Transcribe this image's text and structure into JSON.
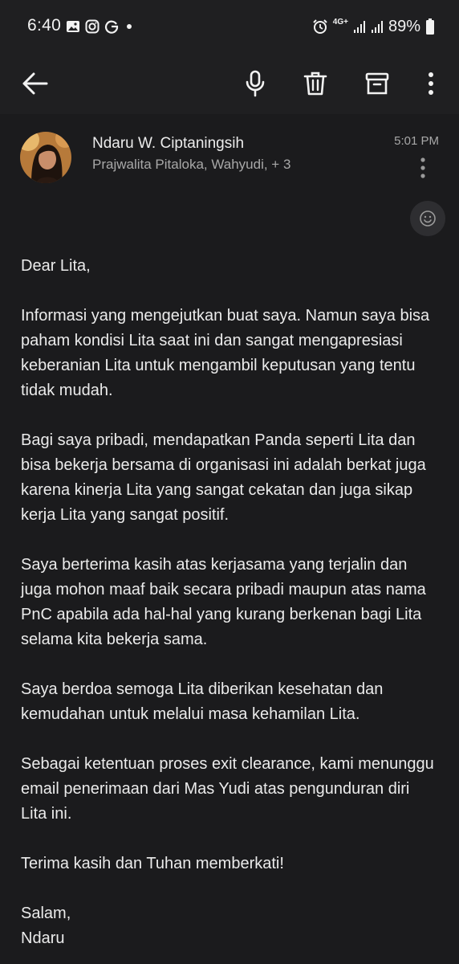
{
  "status_bar": {
    "time": "6:40",
    "network": "4G+",
    "battery": "89%",
    "left_icons": [
      "gallery-icon",
      "instagram-icon",
      "g-icon",
      "dot-icon"
    ],
    "right_icons": [
      "alarm-icon",
      "signal-icon",
      "signal-icon-2",
      "battery-icon"
    ]
  },
  "toolbar": {
    "back_icon": "arrow-left-icon",
    "actions": [
      "microphone-icon",
      "trash-icon",
      "archive-icon",
      "more-vert-icon"
    ]
  },
  "email": {
    "sender_name": "Ndaru W. Ciptaningsih",
    "recipients": "Prajwalita Pitaloka, Wahyudi, + 3",
    "time": "5:01 PM",
    "body": {
      "greeting": "Dear Lita,",
      "p1": "Informasi yang mengejutkan buat saya. Namun saya bisa\npaham kondisi Lita saat ini dan sangat mengapresiasi\nkeberanian Lita untuk mengambil keputusan yang tentu\ntidak mudah.",
      "p2": "Bagi saya pribadi, mendapatkan Panda seperti Lita dan\nbisa bekerja bersama di organisasi ini adalah berkat juga\nkarena kinerja Lita yang sangat cekatan dan juga sikap\nkerja Lita yang sangat positif.",
      "p3": "Saya berterima kasih atas kerjasama yang terjalin dan\njuga mohon maaf baik secara pribadi maupun atas nama\nPnC apabila ada hal-hal yang kurang berkenan bagi Lita\nselama kita bekerja sama.",
      "p4": "Saya berdoa semoga Lita diberikan kesehatan dan\nkemudahan untuk melalui masa kehamilan Lita.",
      "p5": "Sebagai ketentuan proses exit clearance, kami menunggu\nemail penerimaan dari Mas Yudi atas pengunduran diri\nLita ini.",
      "p6": "Terima kasih dan Tuhan memberkati!",
      "signature": "Salam,\nNdaru"
    }
  },
  "colors": {
    "background": "#1b1b1d",
    "toolbar": "#1f1f21",
    "text_primary": "#ebebeb",
    "text_secondary": "#a8a8a8"
  }
}
